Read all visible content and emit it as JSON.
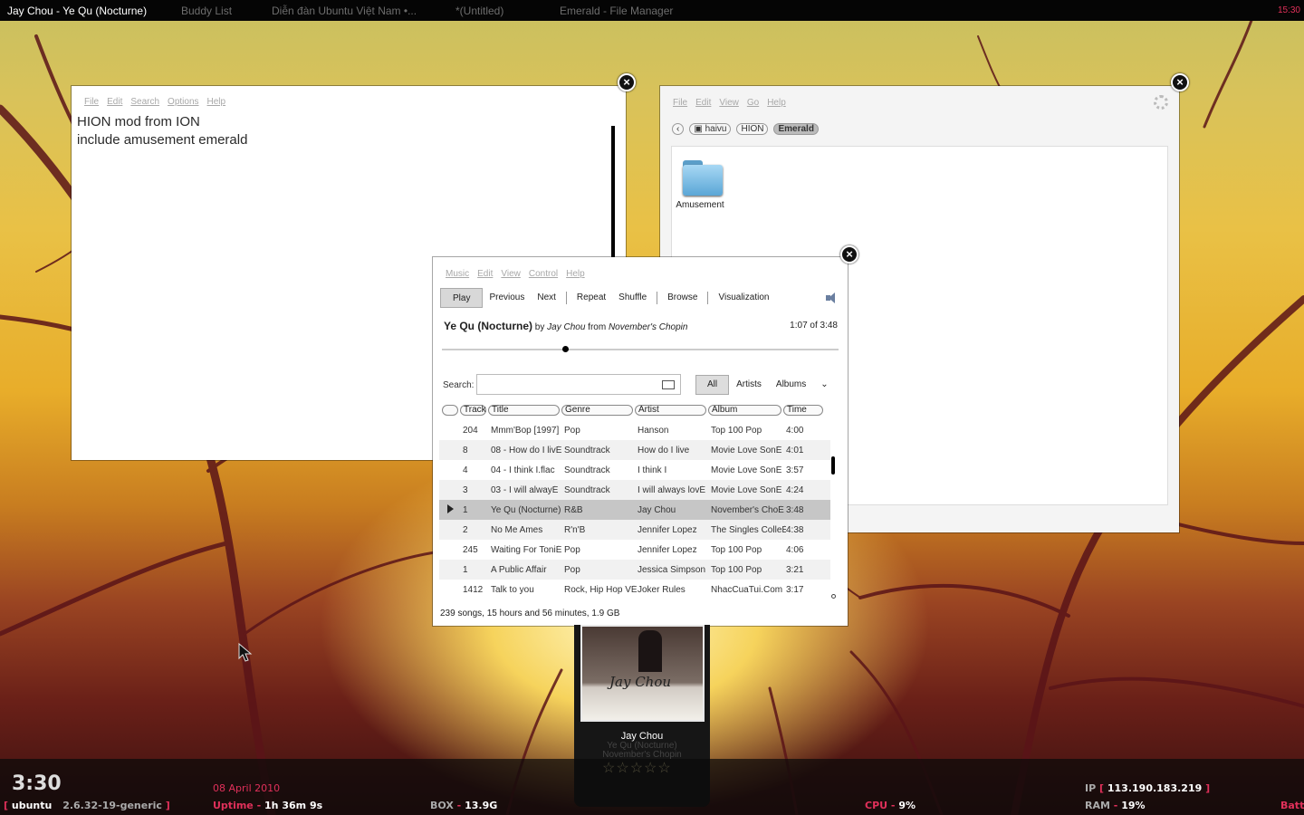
{
  "taskbar": {
    "tasks": [
      "Jay Chou - Ye Qu (Nocturne)",
      "Buddy List",
      "Diễn đàn Ubuntu Việt Nam •...",
      "*(Untitled)",
      "Emerald - File Manager"
    ],
    "clock": "15:30"
  },
  "editor": {
    "menu": [
      "File",
      "Edit",
      "Search",
      "Options",
      "Help"
    ],
    "lines": [
      "HION mod from ION",
      "include amusement emerald"
    ]
  },
  "file_manager": {
    "menu": [
      "File",
      "Edit",
      "View",
      "Go",
      "Help"
    ],
    "path": [
      "haivu",
      "HION",
      "Emerald"
    ],
    "items": [
      {
        "label": "Amusement",
        "icon": "folder-icon"
      }
    ]
  },
  "player": {
    "menu": [
      "Music",
      "Edit",
      "View",
      "Control",
      "Help"
    ],
    "toolbar": {
      "play": "Play",
      "previous": "Previous",
      "next": "Next",
      "repeat": "Repeat",
      "shuffle": "Shuffle",
      "browse": "Browse",
      "visualization": "Visualization"
    },
    "now_playing": {
      "title": "Ye Qu (Nocturne)",
      "by": "by",
      "artist": "Jay Chou",
      "from": "from",
      "album": "November's Chopin",
      "position": "1:07 of 3:48",
      "progress": 0.31
    },
    "search": {
      "label": "Search:",
      "value": ""
    },
    "filters": {
      "all": "All",
      "artists": "Artists",
      "albums": "Albums"
    },
    "columns": [
      "Track",
      "Title",
      "Genre",
      "Artist",
      "Album",
      "Time"
    ],
    "rows": [
      {
        "track": "204",
        "title": "Mmm'Bop [1997]",
        "genre": "Pop",
        "artist": "Hanson",
        "album": "Top 100 Pop",
        "time": "4:00",
        "playing": false
      },
      {
        "track": "8",
        "title": "08 - How do I livÉ",
        "genre": "Soundtrack",
        "artist": "How do I live",
        "album": "Movie Love SonÉ",
        "time": "4:01",
        "playing": false
      },
      {
        "track": "4",
        "title": "04 - I think I.flac",
        "genre": "Soundtrack",
        "artist": "I think I",
        "album": "Movie Love SonÉ",
        "time": "3:57",
        "playing": false
      },
      {
        "track": "3",
        "title": "03 - I will alwayÉ",
        "genre": "Soundtrack",
        "artist": "I will always lovÉ",
        "album": "Movie Love SonÉ",
        "time": "4:24",
        "playing": false
      },
      {
        "track": "1",
        "title": "Ye Qu (Nocturne)",
        "genre": "R&B",
        "artist": "Jay Chou",
        "album": "November's ChoÉ",
        "time": "3:48",
        "playing": true
      },
      {
        "track": "2",
        "title": "No Me Ames",
        "genre": "R'n'B",
        "artist": "Jennifer Lopez",
        "album": "The Singles ColleÉ",
        "time": "4:38",
        "playing": false
      },
      {
        "track": "245",
        "title": "Waiting For ToniÉ",
        "genre": "Pop",
        "artist": "Jennifer Lopez",
        "album": "Top 100 Pop",
        "time": "4:06",
        "playing": false
      },
      {
        "track": "1",
        "title": "A Public Affair",
        "genre": "Pop",
        "artist": "Jessica Simpson",
        "album": "Top 100 Pop",
        "time": "3:21",
        "playing": false
      },
      {
        "track": "1412",
        "title": "Talk to you",
        "genre": "Rock, Hip Hop VÉ",
        "artist": "Joker Rules",
        "album": "NhacCuaTui.Com",
        "time": "3:17",
        "playing": false
      }
    ],
    "status": "239 songs, 15 hours and 56 minutes, 1.9 GB"
  },
  "notification": {
    "artist": "Jay Chou",
    "title": "Ye Qu (Nocturne)",
    "album": "November's Chopin",
    "art_text": "Jay Chou",
    "rating": "☆☆☆☆☆"
  },
  "conky": {
    "time": "3:30",
    "date": "08 April 2010",
    "host": "ubuntu",
    "kernel": "2.6.32-19-generic",
    "uptime_label": "Uptime",
    "uptime": "1h 36m 9s",
    "box_label": "BOX",
    "box": "13.9G",
    "cpu_label": "CPU",
    "cpu": "9%",
    "ip_label": "IP",
    "ip": "113.190.183.219",
    "ram_label": "RAM",
    "ram": "19%",
    "batt_label": "Batt:"
  },
  "colors": {
    "accent": "#e0305a",
    "bar": "#050505"
  }
}
